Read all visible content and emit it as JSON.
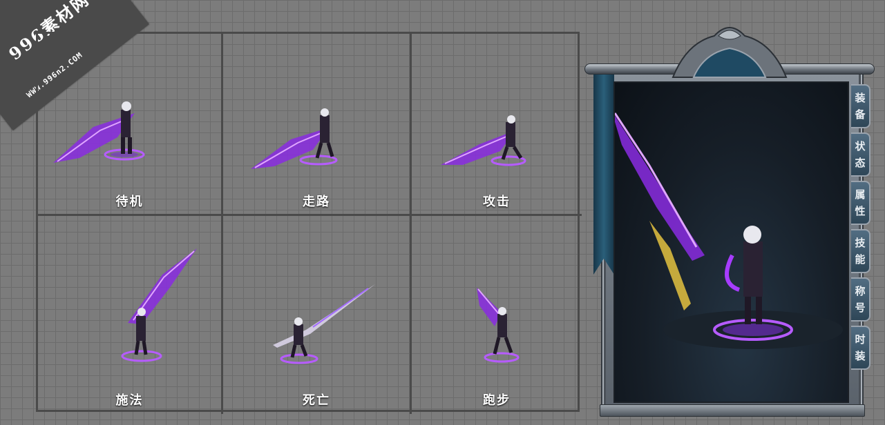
{
  "watermark": {
    "brand": "996素材网",
    "url": "WWW.996n2.COM"
  },
  "animations": [
    {
      "label": "待机"
    },
    {
      "label": "走路"
    },
    {
      "label": "攻击"
    },
    {
      "label": "施法"
    },
    {
      "label": "死亡"
    },
    {
      "label": "跑步"
    }
  ],
  "panel": {
    "tabs": [
      {
        "c1": "装",
        "c2": "备"
      },
      {
        "c1": "状",
        "c2": "态"
      },
      {
        "c1": "属",
        "c2": "性"
      },
      {
        "c1": "技",
        "c2": "能"
      },
      {
        "c1": "称",
        "c2": "号"
      },
      {
        "c1": "时",
        "c2": "装"
      }
    ]
  },
  "colors": {
    "accent": "#a63cff",
    "glow": "#d58bff",
    "gold": "#e4c240",
    "grid_bg": "#7c7c7c",
    "grid_line": "#4a4a4a"
  }
}
